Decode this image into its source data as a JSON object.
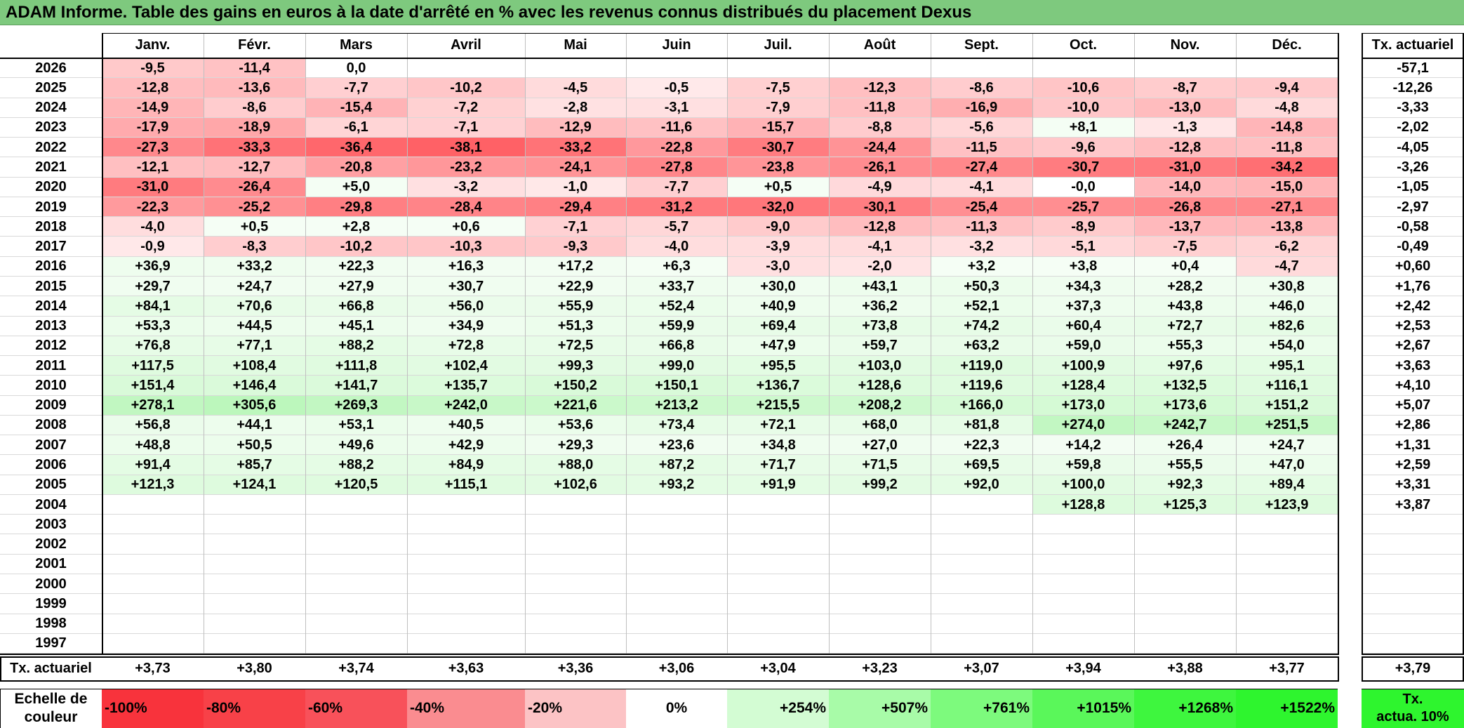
{
  "title": "ADAM Informe. Table des gains en euros à la date d'arrêté en % avec les revenus connus distribués du placement Dexus",
  "months": [
    "Janv.",
    "Févr.",
    "Mars",
    "Avril",
    "Mai",
    "Juin",
    "Juil.",
    "Août",
    "Sept.",
    "Oct.",
    "Nov.",
    "Déc."
  ],
  "actuarial_header": "Tx. actuariel",
  "rows": [
    {
      "year": "2026",
      "values": [
        "-9,5",
        "-11,4",
        "0,0",
        "",
        "",
        "",
        "",
        "",
        "",
        "",
        "",
        ""
      ],
      "actuarial": "-57,1"
    },
    {
      "year": "2025",
      "values": [
        "-12,8",
        "-13,6",
        "-7,7",
        "-10,2",
        "-4,5",
        "-0,5",
        "-7,5",
        "-12,3",
        "-8,6",
        "-10,6",
        "-8,7",
        "-9,4"
      ],
      "actuarial": "-12,26"
    },
    {
      "year": "2024",
      "values": [
        "-14,9",
        "-8,6",
        "-15,4",
        "-7,2",
        "-2,8",
        "-3,1",
        "-7,9",
        "-11,8",
        "-16,9",
        "-10,0",
        "-13,0",
        "-4,8"
      ],
      "actuarial": "-3,33"
    },
    {
      "year": "2023",
      "values": [
        "-17,9",
        "-18,9",
        "-6,1",
        "-7,1",
        "-12,9",
        "-11,6",
        "-15,7",
        "-8,8",
        "-5,6",
        "+8,1",
        "-1,3",
        "-14,8"
      ],
      "actuarial": "-2,02"
    },
    {
      "year": "2022",
      "values": [
        "-27,3",
        "-33,3",
        "-36,4",
        "-38,1",
        "-33,2",
        "-22,8",
        "-30,7",
        "-24,4",
        "-11,5",
        "-9,6",
        "-12,8",
        "-11,8"
      ],
      "actuarial": "-4,05"
    },
    {
      "year": "2021",
      "values": [
        "-12,1",
        "-12,7",
        "-20,8",
        "-23,2",
        "-24,1",
        "-27,8",
        "-23,8",
        "-26,1",
        "-27,4",
        "-30,7",
        "-31,0",
        "-34,2"
      ],
      "actuarial": "-3,26"
    },
    {
      "year": "2020",
      "values": [
        "-31,0",
        "-26,4",
        "+5,0",
        "-3,2",
        "-1,0",
        "-7,7",
        "+0,5",
        "-4,9",
        "-4,1",
        "-0,0",
        "-14,0",
        "-15,0"
      ],
      "actuarial": "-1,05"
    },
    {
      "year": "2019",
      "values": [
        "-22,3",
        "-25,2",
        "-29,8",
        "-28,4",
        "-29,4",
        "-31,2",
        "-32,0",
        "-30,1",
        "-25,4",
        "-25,7",
        "-26,8",
        "-27,1"
      ],
      "actuarial": "-2,97"
    },
    {
      "year": "2018",
      "values": [
        "-4,0",
        "+0,5",
        "+2,8",
        "+0,6",
        "-7,1",
        "-5,7",
        "-9,0",
        "-12,8",
        "-11,3",
        "-8,9",
        "-13,7",
        "-13,8"
      ],
      "actuarial": "-0,58"
    },
    {
      "year": "2017",
      "values": [
        "-0,9",
        "-8,3",
        "-10,2",
        "-10,3",
        "-9,3",
        "-4,0",
        "-3,9",
        "-4,1",
        "-3,2",
        "-5,1",
        "-7,5",
        "-6,2"
      ],
      "actuarial": "-0,49"
    },
    {
      "year": "2016",
      "values": [
        "+36,9",
        "+33,2",
        "+22,3",
        "+16,3",
        "+17,2",
        "+6,3",
        "-3,0",
        "-2,0",
        "+3,2",
        "+3,8",
        "+0,4",
        "-4,7"
      ],
      "actuarial": "+0,60"
    },
    {
      "year": "2015",
      "values": [
        "+29,7",
        "+24,7",
        "+27,9",
        "+30,7",
        "+22,9",
        "+33,7",
        "+30,0",
        "+43,1",
        "+50,3",
        "+34,3",
        "+28,2",
        "+30,8"
      ],
      "actuarial": "+1,76"
    },
    {
      "year": "2014",
      "values": [
        "+84,1",
        "+70,6",
        "+66,8",
        "+56,0",
        "+55,9",
        "+52,4",
        "+40,9",
        "+36,2",
        "+52,1",
        "+37,3",
        "+43,8",
        "+46,0"
      ],
      "actuarial": "+2,42"
    },
    {
      "year": "2013",
      "values": [
        "+53,3",
        "+44,5",
        "+45,1",
        "+34,9",
        "+51,3",
        "+59,9",
        "+69,4",
        "+73,8",
        "+74,2",
        "+60,4",
        "+72,7",
        "+82,6"
      ],
      "actuarial": "+2,53"
    },
    {
      "year": "2012",
      "values": [
        "+76,8",
        "+77,1",
        "+88,2",
        "+72,8",
        "+72,5",
        "+66,8",
        "+47,9",
        "+59,7",
        "+63,2",
        "+59,0",
        "+55,3",
        "+54,0"
      ],
      "actuarial": "+2,67"
    },
    {
      "year": "2011",
      "values": [
        "+117,5",
        "+108,4",
        "+111,8",
        "+102,4",
        "+99,3",
        "+99,0",
        "+95,5",
        "+103,0",
        "+119,0",
        "+100,9",
        "+97,6",
        "+95,1"
      ],
      "actuarial": "+3,63"
    },
    {
      "year": "2010",
      "values": [
        "+151,4",
        "+146,4",
        "+141,7",
        "+135,7",
        "+150,2",
        "+150,1",
        "+136,7",
        "+128,6",
        "+119,6",
        "+128,4",
        "+132,5",
        "+116,1"
      ],
      "actuarial": "+4,10"
    },
    {
      "year": "2009",
      "values": [
        "+278,1",
        "+305,6",
        "+269,3",
        "+242,0",
        "+221,6",
        "+213,2",
        "+215,5",
        "+208,2",
        "+166,0",
        "+173,0",
        "+173,6",
        "+151,2"
      ],
      "actuarial": "+5,07"
    },
    {
      "year": "2008",
      "values": [
        "+56,8",
        "+44,1",
        "+53,1",
        "+40,5",
        "+53,6",
        "+73,4",
        "+72,1",
        "+68,0",
        "+81,8",
        "+274,0",
        "+242,7",
        "+251,5"
      ],
      "actuarial": "+2,86"
    },
    {
      "year": "2007",
      "values": [
        "+48,8",
        "+50,5",
        "+49,6",
        "+42,9",
        "+29,3",
        "+23,6",
        "+34,8",
        "+27,0",
        "+22,3",
        "+14,2",
        "+26,4",
        "+24,7"
      ],
      "actuarial": "+1,31"
    },
    {
      "year": "2006",
      "values": [
        "+91,4",
        "+85,7",
        "+88,2",
        "+84,9",
        "+88,0",
        "+87,2",
        "+71,7",
        "+71,5",
        "+69,5",
        "+59,8",
        "+55,5",
        "+47,0"
      ],
      "actuarial": "+2,59"
    },
    {
      "year": "2005",
      "values": [
        "+121,3",
        "+124,1",
        "+120,5",
        "+115,1",
        "+102,6",
        "+93,2",
        "+91,9",
        "+99,2",
        "+92,0",
        "+100,0",
        "+92,3",
        "+89,4"
      ],
      "actuarial": "+3,31"
    },
    {
      "year": "2004",
      "values": [
        "",
        "",
        "",
        "",
        "",
        "",
        "",
        "",
        "",
        "+128,8",
        "+125,3",
        "+123,9"
      ],
      "actuarial": "+3,87"
    },
    {
      "year": "2003",
      "values": [
        "",
        "",
        "",
        "",
        "",
        "",
        "",
        "",
        "",
        "",
        "",
        ""
      ],
      "actuarial": ""
    },
    {
      "year": "2002",
      "values": [
        "",
        "",
        "",
        "",
        "",
        "",
        "",
        "",
        "",
        "",
        "",
        ""
      ],
      "actuarial": ""
    },
    {
      "year": "2001",
      "values": [
        "",
        "",
        "",
        "",
        "",
        "",
        "",
        "",
        "",
        "",
        "",
        ""
      ],
      "actuarial": ""
    },
    {
      "year": "2000",
      "values": [
        "",
        "",
        "",
        "",
        "",
        "",
        "",
        "",
        "",
        "",
        "",
        ""
      ],
      "actuarial": ""
    },
    {
      "year": "1999",
      "values": [
        "",
        "",
        "",
        "",
        "",
        "",
        "",
        "",
        "",
        "",
        "",
        ""
      ],
      "actuarial": ""
    },
    {
      "year": "1998",
      "values": [
        "",
        "",
        "",
        "",
        "",
        "",
        "",
        "",
        "",
        "",
        "",
        ""
      ],
      "actuarial": ""
    },
    {
      "year": "1997",
      "values": [
        "",
        "",
        "",
        "",
        "",
        "",
        "",
        "",
        "",
        "",
        "",
        ""
      ],
      "actuarial": ""
    }
  ],
  "footer": {
    "label": "Tx. actuariel",
    "values": [
      "+3,73",
      "+3,80",
      "+3,74",
      "+3,63",
      "+3,36",
      "+3,06",
      "+3,04",
      "+3,23",
      "+3,07",
      "+3,94",
      "+3,88",
      "+3,77"
    ],
    "actuarial": "+3,79"
  },
  "scale": {
    "label_line1": "Echelle de",
    "label_line2": "couleur",
    "steps": [
      {
        "text": "-100%",
        "color": "#f8333c",
        "align": "left"
      },
      {
        "text": "-80%",
        "color": "#f84148",
        "align": "left"
      },
      {
        "text": "-60%",
        "color": "#f8515a",
        "align": "left"
      },
      {
        "text": "-40%",
        "color": "#fa8c90",
        "align": "left"
      },
      {
        "text": "-20%",
        "color": "#fcc3c5",
        "align": "left"
      },
      {
        "text": "0%",
        "color": "#ffffff",
        "align": "center"
      },
      {
        "text": "+254%",
        "color": "#d3fcd3",
        "align": "right"
      },
      {
        "text": "+507%",
        "color": "#a8fba8",
        "align": "right"
      },
      {
        "text": "+761%",
        "color": "#7dfa7d",
        "align": "right"
      },
      {
        "text": "+1015%",
        "color": "#5af75a",
        "align": "right"
      },
      {
        "text": "+1268%",
        "color": "#3ef63e",
        "align": "right"
      },
      {
        "text": "+1522%",
        "color": "#2ef52e",
        "align": "right"
      }
    ],
    "legend_line1": "Tx.",
    "legend_line2": "actua. 10%",
    "legend_color": "#2ef52e"
  },
  "colors": {
    "title_bg": "#7ec97e",
    "neg_full": "#ff5a5f",
    "pos_full": "#86f086"
  }
}
